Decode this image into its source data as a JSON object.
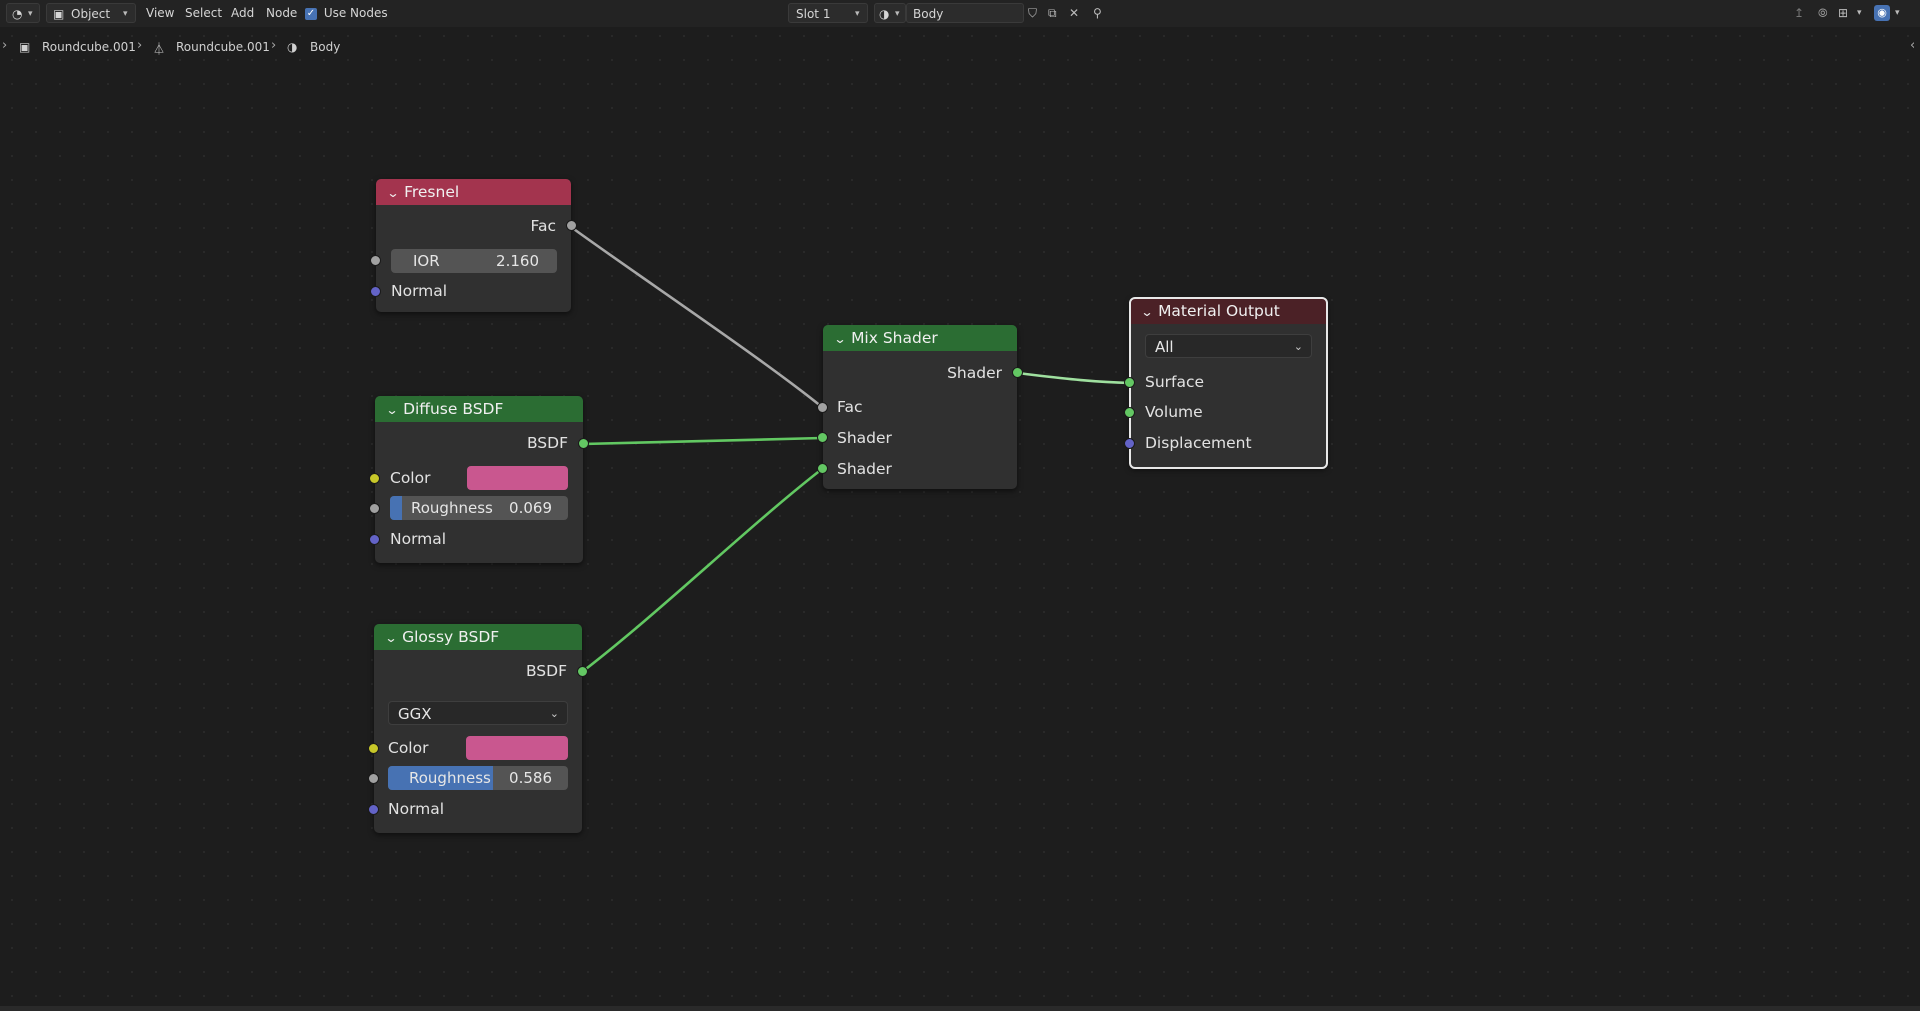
{
  "header": {
    "editor_type_icon": "node-editor-icon",
    "mode": "Object",
    "menus": [
      "View",
      "Select",
      "Add",
      "Node"
    ],
    "use_nodes_label": "Use Nodes",
    "use_nodes_checked": true,
    "slot": "Slot 1",
    "material_name": "Body"
  },
  "breadcrumb": {
    "items": [
      "Roundcube.001",
      "Roundcube.001",
      "Body"
    ]
  },
  "nodes": {
    "fresnel": {
      "title": "Fresnel",
      "output": "Fac",
      "ior_label": "IOR",
      "ior_value": "2.160",
      "normal_label": "Normal"
    },
    "diffuse": {
      "title": "Diffuse BSDF",
      "output": "BSDF",
      "color_label": "Color",
      "color": "#c9578f",
      "roughness_label": "Roughness",
      "roughness_value": "0.069",
      "roughness": 0.069,
      "normal_label": "Normal"
    },
    "glossy": {
      "title": "Glossy BSDF",
      "output": "BSDF",
      "distribution": "GGX",
      "color_label": "Color",
      "color": "#c9578f",
      "roughness_label": "Roughness",
      "roughness_value": "0.586",
      "roughness": 0.586,
      "normal_label": "Normal"
    },
    "mix": {
      "title": "Mix Shader",
      "output": "Shader",
      "fac_label": "Fac",
      "shader1_label": "Shader",
      "shader2_label": "Shader"
    },
    "output": {
      "title": "Material Output",
      "target": "All",
      "surface_label": "Surface",
      "volume_label": "Volume",
      "displacement_label": "Displacement"
    }
  },
  "colors": {
    "fresnel_header": "#a3344e",
    "shader_header": "#2b6d33",
    "output_header": "#4b2126",
    "shader_socket": "#63c763",
    "float_socket": "#a1a1a1",
    "vector_socket": "#6363c7",
    "color_socket": "#c7c729"
  }
}
